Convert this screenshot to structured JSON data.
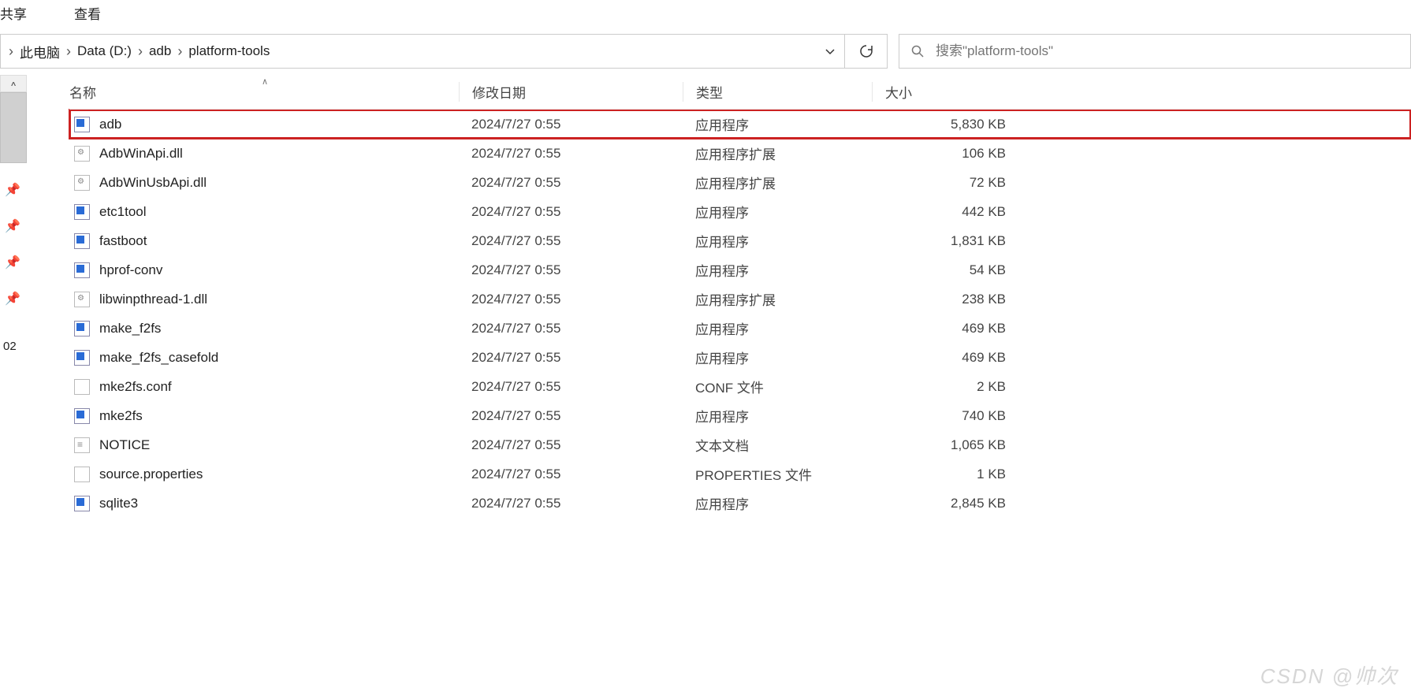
{
  "top_menu": {
    "share": "共享",
    "view": "查看"
  },
  "breadcrumb": {
    "items": [
      "此电脑",
      "Data (D:)",
      "adb",
      "platform-tools"
    ]
  },
  "refresh_tip": "刷新",
  "search": {
    "placeholder": "搜索\"platform-tools\""
  },
  "left": {
    "date_frag": "02"
  },
  "headers": {
    "name": "名称",
    "date": "修改日期",
    "type": "类型",
    "size": "大小"
  },
  "files": [
    {
      "name": "adb",
      "date": "2024/7/27 0:55",
      "type": "应用程序",
      "size": "5,830 KB",
      "icon": "exe",
      "highlight": true
    },
    {
      "name": "AdbWinApi.dll",
      "date": "2024/7/27 0:55",
      "type": "应用程序扩展",
      "size": "106 KB",
      "icon": "dll"
    },
    {
      "name": "AdbWinUsbApi.dll",
      "date": "2024/7/27 0:55",
      "type": "应用程序扩展",
      "size": "72 KB",
      "icon": "dll"
    },
    {
      "name": "etc1tool",
      "date": "2024/7/27 0:55",
      "type": "应用程序",
      "size": "442 KB",
      "icon": "exe"
    },
    {
      "name": "fastboot",
      "date": "2024/7/27 0:55",
      "type": "应用程序",
      "size": "1,831 KB",
      "icon": "exe"
    },
    {
      "name": "hprof-conv",
      "date": "2024/7/27 0:55",
      "type": "应用程序",
      "size": "54 KB",
      "icon": "exe"
    },
    {
      "name": "libwinpthread-1.dll",
      "date": "2024/7/27 0:55",
      "type": "应用程序扩展",
      "size": "238 KB",
      "icon": "dll"
    },
    {
      "name": "make_f2fs",
      "date": "2024/7/27 0:55",
      "type": "应用程序",
      "size": "469 KB",
      "icon": "exe"
    },
    {
      "name": "make_f2fs_casefold",
      "date": "2024/7/27 0:55",
      "type": "应用程序",
      "size": "469 KB",
      "icon": "exe"
    },
    {
      "name": "mke2fs.conf",
      "date": "2024/7/27 0:55",
      "type": "CONF 文件",
      "size": "2 KB",
      "icon": "file"
    },
    {
      "name": "mke2fs",
      "date": "2024/7/27 0:55",
      "type": "应用程序",
      "size": "740 KB",
      "icon": "exe"
    },
    {
      "name": "NOTICE",
      "date": "2024/7/27 0:55",
      "type": "文本文档",
      "size": "1,065 KB",
      "icon": "txt"
    },
    {
      "name": "source.properties",
      "date": "2024/7/27 0:55",
      "type": "PROPERTIES 文件",
      "size": "1 KB",
      "icon": "file"
    },
    {
      "name": "sqlite3",
      "date": "2024/7/27 0:55",
      "type": "应用程序",
      "size": "2,845 KB",
      "icon": "exe"
    }
  ],
  "watermark": "CSDN @帅次"
}
